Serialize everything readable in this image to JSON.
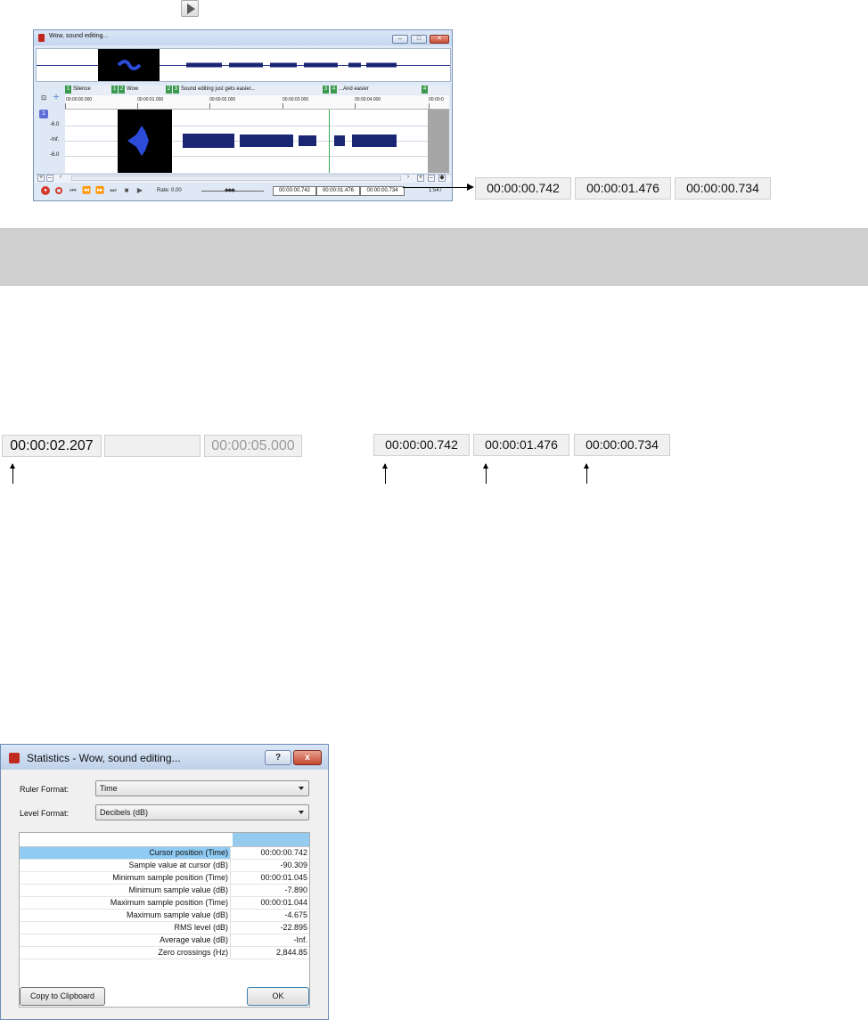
{
  "editor": {
    "title": "Wow, sound editing...",
    "regions": [
      {
        "markers": [
          "1"
        ],
        "label": "Silence"
      },
      {
        "markers": [
          "1",
          "2"
        ],
        "label": "Wow"
      },
      {
        "markers": [
          "2",
          "3"
        ],
        "label": "Sound editing just gets easier..."
      },
      {
        "markers": [
          "3",
          "4"
        ],
        "label": "...And easier"
      },
      {
        "markers": [
          "4"
        ],
        "label": ""
      }
    ],
    "ruler_ticks": [
      "00:00:00.000",
      "00:00:01.000",
      "00:00:02.000",
      "00:00:03.000",
      "00:00:04.000",
      "00:00:0"
    ],
    "db_labels": [
      "-6.0",
      "-Inf.",
      "-6.0"
    ],
    "rate_label": "Rate: 0.00",
    "selection": {
      "start": "00:00:00.742",
      "end": "00:00:01.476",
      "length": "00:00:00.734"
    },
    "zoom_ratio": "1:547"
  },
  "callout_top": {
    "start": "00:00:00.742",
    "end": "00:00:01.476",
    "length": "00:00:00.734"
  },
  "callout_cursor": {
    "cursor": "00:00:02.207",
    "empty": "",
    "total": "00:00:05.000"
  },
  "callout_selection": {
    "start": "00:00:00.742",
    "end": "00:00:01.476",
    "length": "00:00:00.734"
  },
  "statistics": {
    "title": "Statistics - Wow, sound editing...",
    "help_label": "?",
    "close_label": "x",
    "ruler_format_label": "Ruler Format:",
    "ruler_format_value": "Time",
    "level_format_label": "Level Format:",
    "level_format_value": "Decibels (dB)",
    "rows": [
      {
        "label": "Cursor position (Time)",
        "value": "00:00:00.742"
      },
      {
        "label": "Sample value at cursor (dB)",
        "value": "-90.309"
      },
      {
        "label": "Minimum sample position (Time)",
        "value": "00:00:01.045"
      },
      {
        "label": "Minimum sample value (dB)",
        "value": "-7.890"
      },
      {
        "label": "Maximum sample position (Time)",
        "value": "00:00:01.044"
      },
      {
        "label": "Maximum sample value (dB)",
        "value": "-4.675"
      },
      {
        "label": "RMS level (dB)",
        "value": "-22.895"
      },
      {
        "label": "Average value (dB)",
        "value": "-Inf."
      },
      {
        "label": "Zero crossings (Hz)",
        "value": "2,844.85"
      }
    ],
    "copy_label": "Copy to Clipboard",
    "ok_label": "OK"
  }
}
